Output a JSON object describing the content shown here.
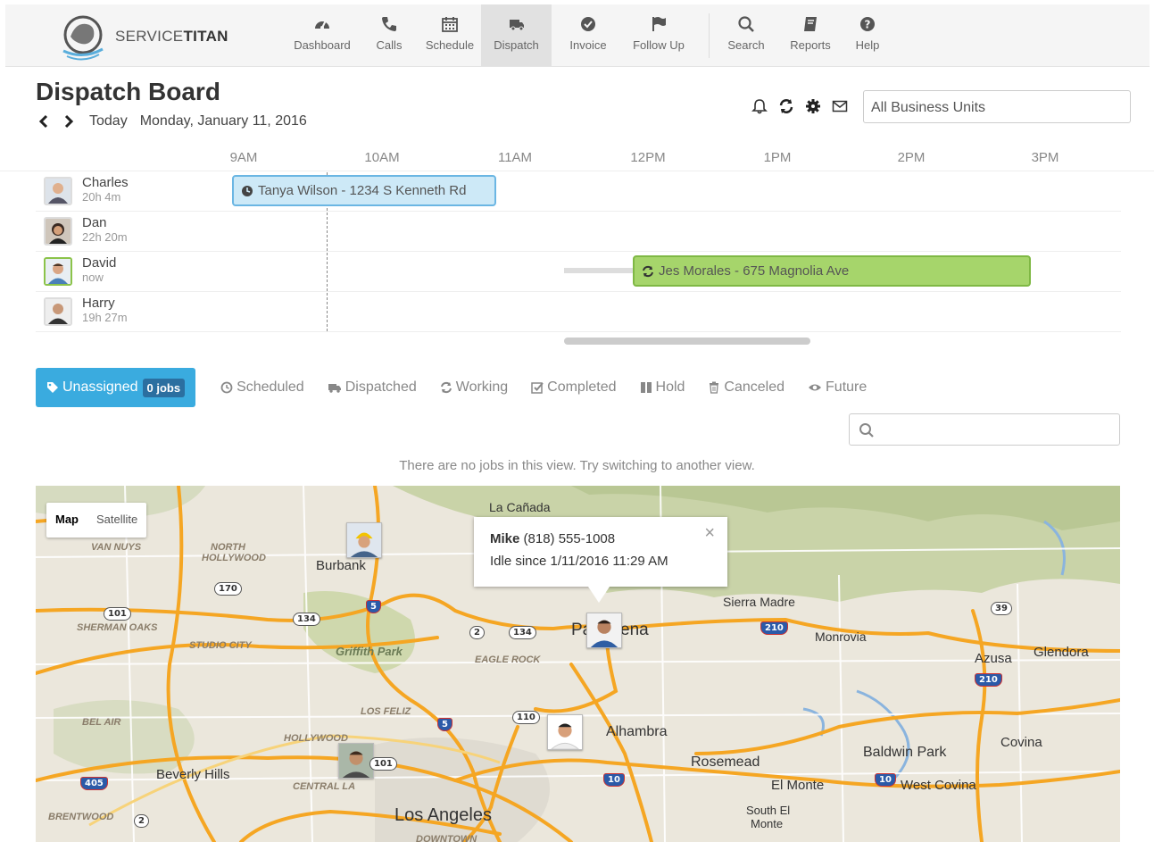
{
  "brand": {
    "name_light": "SERVICE",
    "name_bold": "TITAN"
  },
  "nav": [
    {
      "label": "Dashboard",
      "icon": "dashboard-icon"
    },
    {
      "label": "Calls",
      "icon": "phone-icon"
    },
    {
      "label": "Schedule",
      "icon": "calendar-icon"
    },
    {
      "label": "Dispatch",
      "icon": "truck-icon",
      "active": true
    },
    {
      "label": "Invoice",
      "icon": "check-circle-icon"
    },
    {
      "label": "Follow Up",
      "icon": "flag-icon"
    },
    {
      "label": "Search",
      "icon": "search-icon"
    },
    {
      "label": "Reports",
      "icon": "book-icon"
    },
    {
      "label": "Help",
      "icon": "help-icon"
    }
  ],
  "header": {
    "title": "Dispatch Board",
    "today": "Today",
    "date": "Monday, January 11, 2016",
    "business_unit": "All Business Units"
  },
  "timeline": {
    "hours": [
      "9AM",
      "10AM",
      "11AM",
      "12PM",
      "1PM",
      "2PM",
      "3PM"
    ],
    "technicians": [
      {
        "name": "Charles",
        "sub": "20h 4m"
      },
      {
        "name": "Dan",
        "sub": "22h 20m"
      },
      {
        "name": "David",
        "sub": "now"
      },
      {
        "name": "Harry",
        "sub": "19h 27m"
      }
    ],
    "jobs": [
      {
        "label": "Tanya Wilson - 1234 S Kenneth Rd",
        "status": "scheduled"
      },
      {
        "label": "Jes Morales - 675 Magnolia Ave",
        "status": "working"
      }
    ]
  },
  "tabs": {
    "unassigned": "Unassigned",
    "unassigned_count": "0 jobs",
    "scheduled": "Scheduled",
    "dispatched": "Dispatched",
    "working": "Working",
    "completed": "Completed",
    "hold": "Hold",
    "canceled": "Canceled",
    "future": "Future"
  },
  "empty_message": "There are no jobs in this view. Try switching to another view.",
  "map": {
    "toggle_map": "Map",
    "toggle_satellite": "Satellite",
    "popup": {
      "name": "Mike",
      "phone": "(818) 555-1008",
      "status": "Idle since 1/11/2016 11:29 AM",
      "close": "×"
    },
    "places": {
      "la_canada": "La Cañada",
      "van_nuys": "VAN NUYS",
      "north": "NORTH",
      "hollywood_n": "HOLLYWOOD",
      "burbank": "Burbank",
      "sherman_oaks": "SHERMAN OAKS",
      "studio_city": "STUDIO CITY",
      "griffith_park": "Griffith Park",
      "eagle_rock": "EAGLE ROCK",
      "pasadena_a": "Pa",
      "pasadena_b": "ena",
      "sierra_madre": "Sierra Madre",
      "monrovia": "Monrovia",
      "azusa": "Azusa",
      "glendora": "Glendora",
      "bel_air": "BEL AIR",
      "los_feliz": "LOS FELIZ",
      "hollywood": "HOLLYWOOD",
      "alhambra": "Alhambra",
      "rosemead": "Rosemead",
      "baldwin_park": "Baldwin Park",
      "covina": "Covina",
      "beverly_hills": "Beverly Hills",
      "central_la": "CENTRAL LA",
      "el_monte": "El Monte",
      "west_covina": "West Covina",
      "south": "South El",
      "monte": "Monte",
      "brentwood": "BRENTWOOD",
      "los_angeles": "Los Angeles",
      "downtown": "DOWNTOWN"
    },
    "shields": [
      "170",
      "101",
      "134",
      "5",
      "2",
      "134",
      "210",
      "39",
      "110",
      "5",
      "101",
      "405",
      "10",
      "10",
      "210",
      "2"
    ]
  },
  "colors": {
    "accent": "#3aabdf",
    "scheduled_job": "#cde9f7",
    "working_job": "#a6d56b",
    "road": "#f5a623"
  }
}
